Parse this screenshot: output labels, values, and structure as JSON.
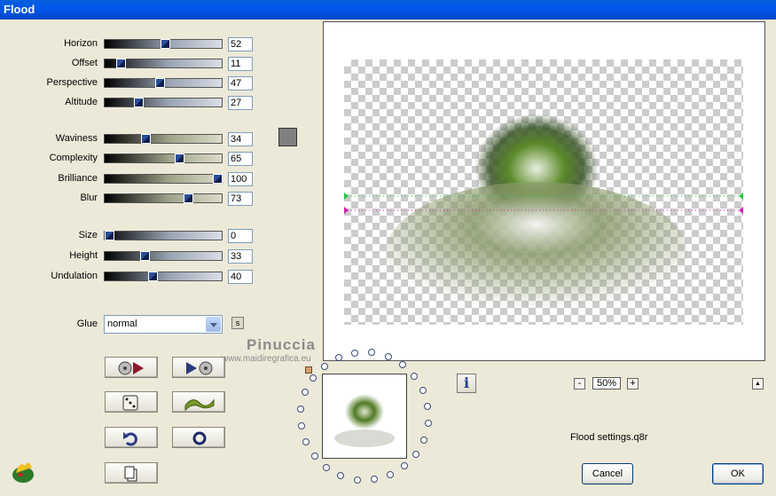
{
  "window": {
    "title": "Flood"
  },
  "params": [
    {
      "id": "horizon",
      "label": "Horizon",
      "value": "52",
      "level": 52,
      "style": "blue"
    },
    {
      "id": "offset",
      "label": "Offset",
      "value": "11",
      "level": 11,
      "style": "blue"
    },
    {
      "id": "perspective",
      "label": "Perspective",
      "value": "47",
      "level": 47,
      "style": "blue"
    },
    {
      "id": "altitude",
      "label": "Altitude",
      "value": "27",
      "level": 27,
      "style": "blue"
    },
    {
      "id": "waviness",
      "label": "Waviness",
      "value": "34",
      "level": 34,
      "style": "yellow"
    },
    {
      "id": "complexity",
      "label": "Complexity",
      "value": "65",
      "level": 65,
      "style": "yellow"
    },
    {
      "id": "brilliance",
      "label": "Brilliance",
      "value": "100",
      "level": 100,
      "style": "yellow"
    },
    {
      "id": "blur",
      "label": "Blur",
      "value": "73",
      "level": 73,
      "style": "yellow"
    },
    {
      "id": "size",
      "label": "Size",
      "value": "0",
      "level": 0,
      "style": "blue"
    },
    {
      "id": "height",
      "label": "Height",
      "value": "33",
      "level": 33,
      "style": "blue"
    },
    {
      "id": "undulation",
      "label": "Undulation",
      "value": "40",
      "level": 40,
      "style": "blue"
    }
  ],
  "color_swatch": "#808080",
  "glue": {
    "label": "Glue",
    "value": "normal"
  },
  "watermark": {
    "name": "Pinuccia",
    "url": "www.maidiregrafica.eu"
  },
  "zoom": {
    "minus": "-",
    "value": "50%",
    "plus": "+"
  },
  "scroll_up_label": "▲",
  "info_label": "i",
  "settings_file": "Flood settings.q8r",
  "buttons": {
    "cancel": "Cancel",
    "ok": "OK"
  },
  "icons": {
    "load-preset": "load-preset-icon",
    "save-preset": "save-preset-icon",
    "randomize": "dice-icon",
    "wave": "wave-icon",
    "undo": "undo-icon",
    "reset": "reset-icon",
    "copy": "copy-icon",
    "logo": "app-logo-icon"
  }
}
